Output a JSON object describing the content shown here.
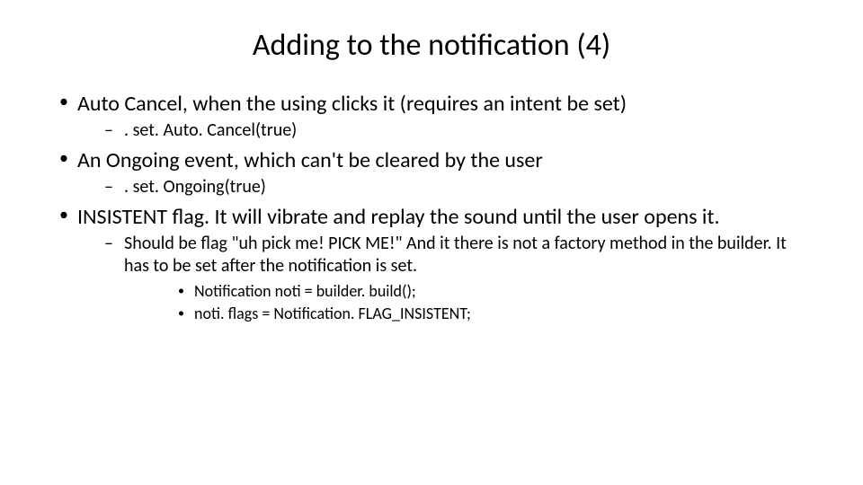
{
  "title": "Adding to the notification (4)",
  "bullets": [
    {
      "text": "Auto Cancel, when the using clicks it (requires an intent be set)",
      "children": [
        {
          "text": ". set. Auto. Cancel(true)"
        }
      ]
    },
    {
      "text": "An Ongoing event, which can't be cleared by the user",
      "children": [
        {
          "text": ". set. Ongoing(true)"
        }
      ]
    },
    {
      "text": "INSISTENT flag.  It will vibrate and replay the sound until the user opens it.",
      "children": [
        {
          "text": "Should be flag \"uh pick me!  PICK ME!\" And it there is not a factory method in the builder.  It has to be set after the notification is set.",
          "children": [
            {
              "text": "Notification noti = builder. build();"
            },
            {
              "text": "noti. flags = Notification. FLAG_INSISTENT;"
            }
          ]
        }
      ]
    }
  ]
}
